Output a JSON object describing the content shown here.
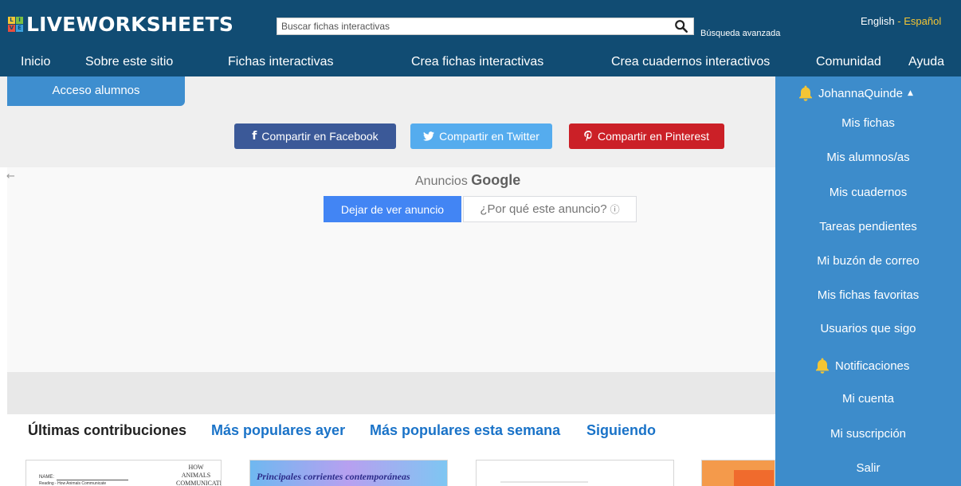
{
  "header": {
    "logo_text": "LIVEWORKSHEETS",
    "logo_letters": [
      "L",
      "I",
      "V",
      "E"
    ],
    "search": {
      "placeholder": "Buscar fichas interactivas",
      "advanced_label": "Búsqueda avanzada"
    },
    "language": {
      "english": "English",
      "separator": "-",
      "spanish": "Español"
    }
  },
  "nav": {
    "items": [
      "Inicio",
      "Sobre este sitio",
      "Fichas interactivas",
      "Crea fichas interactivas",
      "Crea cuadernos interactivos",
      "Comunidad",
      "Ayuda"
    ]
  },
  "student_access": {
    "label": "Acceso alumnos"
  },
  "share": {
    "facebook": "Compartir en Facebook",
    "twitter": "Compartir en Twitter",
    "pinterest": "Compartir en Pinterest"
  },
  "ad": {
    "back_arrow": "←",
    "title_prefix": "Anuncios",
    "title_brand": "Google",
    "stop_label": "Dejar de ver anuncio",
    "why_label": "¿Por qué este anuncio?",
    "info_glyph": "ⓘ"
  },
  "tabs": [
    "Últimas contribuciones",
    "Más populares ayer",
    "Más populares esta semana",
    "Siguiendo"
  ],
  "thumbnails": {
    "t1_name": "NAME:",
    "t1_reading": "Reading - How Animals Communicate",
    "t1_title": "HOW ANIMALS COMMUNICATE",
    "t2_title": "Principales corrientes contemporáneas"
  },
  "sidebar": {
    "username": "JohannaQuinde",
    "items": [
      "Mis fichas",
      "Mis alumnos/as",
      "Mis cuadernos",
      "Tareas pendientes",
      "Mi buzón de correo",
      "Mis fichas favoritas",
      "Usuarios que sigo"
    ],
    "notifications": "Notificaciones",
    "items2": [
      "Mi cuenta",
      "Mi suscripción",
      "Salir"
    ]
  },
  "colors": {
    "header_bg": "#114c73",
    "sidebar_bg": "#3d8ccb",
    "accent_yellow": "#f4c534",
    "link_blue": "#1a73c8"
  },
  "icons": [
    "search-icon",
    "bell-icon",
    "caret-up-icon",
    "facebook-icon",
    "twitter-icon",
    "pinterest-icon",
    "info-icon",
    "back-arrow-icon"
  ]
}
